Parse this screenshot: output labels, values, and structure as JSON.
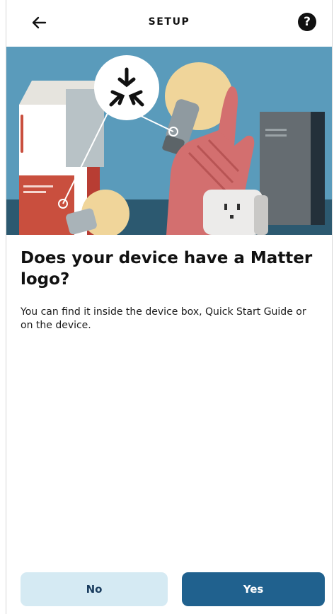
{
  "header": {
    "title": "SETUP",
    "back_icon": "back-arrow-icon",
    "help_icon": "help-icon",
    "help_glyph": "?"
  },
  "hero": {
    "illustration": "matter-devices-illustration",
    "colors": {
      "sky": "#5a9bbb",
      "floor": "#2c5970",
      "accent_red": "#c94f3e",
      "hand": "#d36f6f",
      "bulb": "#f0d59a",
      "cabinet": "#656c71"
    }
  },
  "main": {
    "heading": "Does your device have a Matter logo?",
    "description": "You can find it inside the device box, Quick Start Guide or on the device."
  },
  "actions": {
    "no_label": "No",
    "yes_label": "Yes"
  },
  "colors": {
    "primary": "#20618e",
    "secondary": "#d5eaf3"
  }
}
